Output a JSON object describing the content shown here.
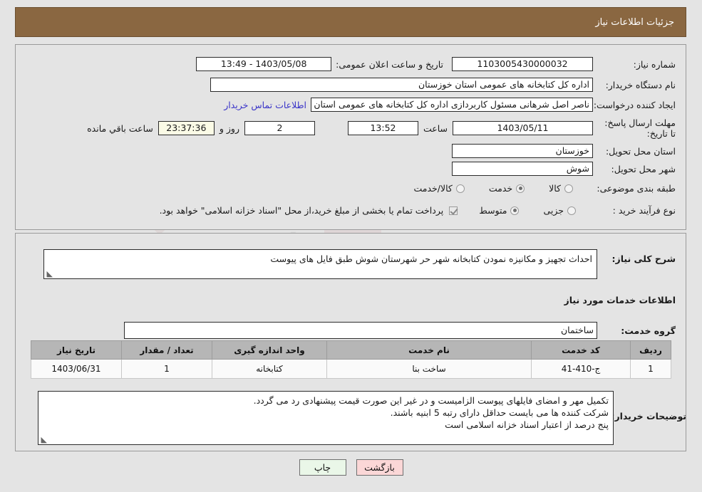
{
  "header": {
    "title": "جزئیات اطلاعات نیاز"
  },
  "watermark": {
    "line1": "AriaTender",
    "line2": ".net"
  },
  "top_form": {
    "need_number_label": "شماره نیاز:",
    "need_number_value": "1103005430000032",
    "public_announce_label": "تاریخ و ساعت اعلان عمومی:",
    "public_announce_value": "1403/05/08 - 13:49",
    "buyer_org_label": "نام دستگاه خریدار:",
    "buyer_org_value": "اداره کل کتابخانه های عمومی استان خوزستان",
    "creator_label": "ایجاد کننده درخواست:",
    "creator_value": "ناصر اصل شرهانی مسئول کاربردازی اداره کل کتابخانه های عمومی استان خوزستان",
    "contact_link": "اطلاعات تماس خریدار",
    "deadline_label": "مهلت ارسال پاسخ: تا تاریخ:",
    "deadline_date": "1403/05/11",
    "hour_label": "ساعت",
    "deadline_time": "13:52",
    "days_value": "2",
    "days_label": "روز و",
    "countdown_value": "23:37:36",
    "countdown_label": "ساعت باقي مانده",
    "province_label": "استان محل تحویل:",
    "province_value": "خوزستان",
    "city_label": "شهر محل تحویل:",
    "city_value": "شوش",
    "classification_label": "طبقه بندی موضوعی:",
    "classification_options": [
      {
        "label": "کالا",
        "selected": false
      },
      {
        "label": "خدمت",
        "selected": true
      },
      {
        "label": "کالا/خدمت",
        "selected": false
      }
    ],
    "process_label": "نوع فرآیند خرید :",
    "process_options": [
      {
        "label": "جزیی",
        "selected": false
      },
      {
        "label": "متوسط",
        "selected": true
      }
    ],
    "treasury_checkbox_checked": true,
    "treasury_note": "پرداخت تمام یا بخشی از مبلغ خرید،از محل \"اسناد خزانه اسلامی\" خواهد بود."
  },
  "middle": {
    "general_desc_label": "شرح کلی نیاز:",
    "general_desc_value": "احداث تجهیز و مکانیزه نمودن کتابخانه شهر حر شهرستان شوش طبق فایل های پیوست",
    "services_section_title": "اطلاعات خدمات مورد نیاز",
    "service_group_label": "گروه خدمت:",
    "service_group_value": "ساختمان"
  },
  "table": {
    "columns": [
      "ردیف",
      "کد خدمت",
      "نام خدمت",
      "واحد اندازه گیری",
      "تعداد / مقدار",
      "تاریخ نیاز"
    ],
    "rows": [
      {
        "row": "1",
        "code": "ج-410-41",
        "name": "ساخت بنا",
        "unit": "کتابخانه",
        "qty": "1",
        "date": "1403/06/31"
      }
    ]
  },
  "buyer_notes": {
    "label": "توضیحات خریدار:",
    "lines": [
      "تکمیل مهر و امضای فایلهای پیوست الزامیست و در غیر این صورت قیمت پیشنهادی رد می گردد.",
      "شرکت کننده ها می بایست حداقل دارای رتبه 5 ابنیه باشند.",
      "پنج درصد از اعتبار اسناد خزانه اسلامی است"
    ]
  },
  "buttons": {
    "print": "چاپ",
    "back": "بازگشت"
  },
  "colors": {
    "header_bg": "#8a6741",
    "link": "#3a34c8",
    "table_header_bg": "#b6b6b6",
    "print_btn_bg": "#eaf7e8",
    "back_btn_bg": "#fbd7d7",
    "countdown_bg": "#fbfbe6"
  }
}
